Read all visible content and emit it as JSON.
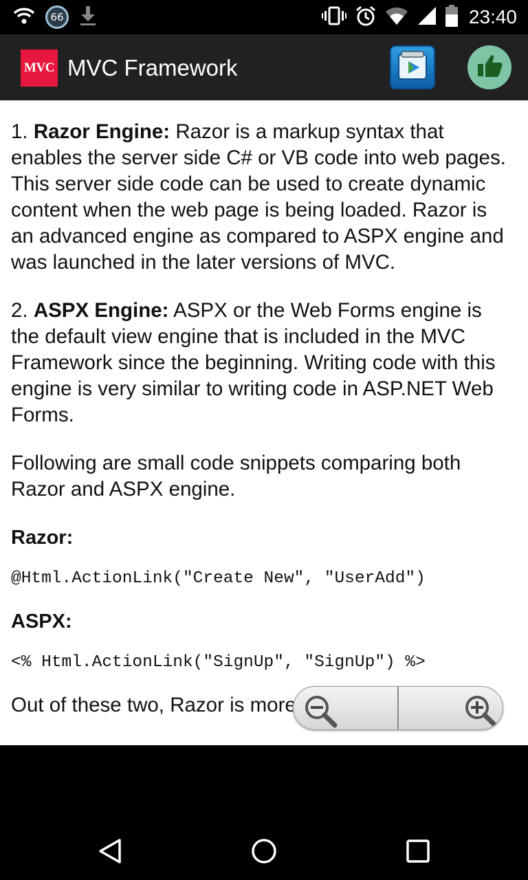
{
  "status_bar": {
    "notification_badge": "66",
    "time": "23:40",
    "icons": [
      "wifi-icon",
      "notification-badge",
      "download-icon",
      "vibrate-icon",
      "alarm-icon",
      "wifi-signal-icon",
      "cell-signal-icon",
      "battery-icon"
    ]
  },
  "app_bar": {
    "logo_text": "MVC",
    "title": "MVC Framework",
    "icons": [
      "play-store-icon",
      "thumbs-up-icon"
    ]
  },
  "content": {
    "p1": {
      "number": "1. ",
      "term": "Razor Engine:",
      "text": " Razor is a markup syntax that enables the server side C# or VB code into web pages. This server side code can be used to create dynamic content when the web page is being loaded. Razor is an advanced engine as compared to ASPX engine and was launched in the later versions of MVC."
    },
    "p2": {
      "number": "2. ",
      "term": "ASPX Engine:",
      "text": " ASPX or the Web Forms engine is the default view engine that is included in the MVC Framework since the beginning. Writing code with this engine is very similar to writing code in ASP.NET Web Forms."
    },
    "p3": "Following are small code snippets comparing both Razor and ASPX engine.",
    "razor_heading": "Razor:",
    "razor_code": "@Html.ActionLink(\"Create New\", \"UserAdd\")",
    "aspx_heading": "ASPX:",
    "aspx_code": "<% Html.ActionLink(\"SignUp\", \"SignUp\") %>",
    "p4": "Out of these two, Razor is more advanced View"
  },
  "zoom_control": {
    "icons": [
      "zoom-out-icon",
      "zoom-in-icon"
    ]
  },
  "nav_bar": {
    "icons": [
      "back-icon",
      "home-icon",
      "recents-icon"
    ]
  }
}
